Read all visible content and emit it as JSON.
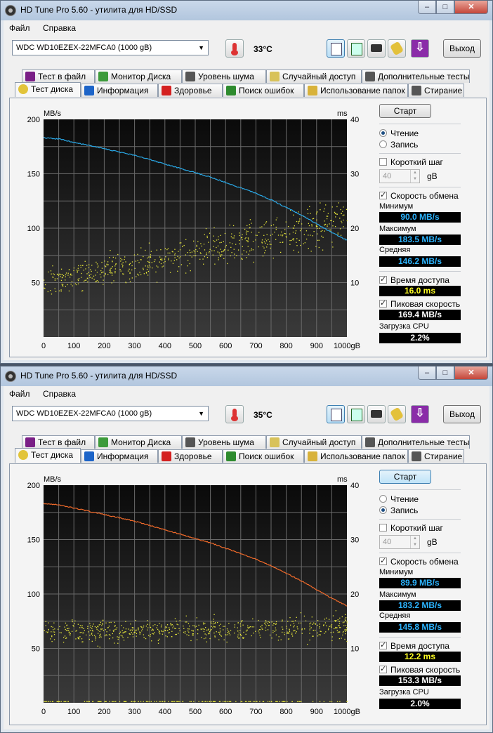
{
  "windows": [
    {
      "title": "HD Tune Pro 5.60 - утилита для HD/SSD",
      "menu": [
        "Файл",
        "Справка"
      ],
      "drive": "WDC WD10EZEX-22MFCA0 (1000 gB)",
      "temperature": "33°C",
      "exit_label": "Выход",
      "tabs_top": [
        "Тест в файл",
        "Монитор Диска",
        "Уровень шума",
        "Случайный доступ",
        "Дополнительные  тесты"
      ],
      "tabs_bottom": [
        "Тест диска",
        "Информация",
        "Здоровье",
        "Поиск ошибок",
        "Использование папок",
        "Стирание"
      ],
      "start_label": "Старт",
      "read_label": "Чтение",
      "write_label": "Запись",
      "mode": "read",
      "short_step_label": "Короткий шаг",
      "short_step_value": "40",
      "short_step_unit": "gB",
      "transfer_rate_label": "Скорость обмена",
      "min_label": "Минимум",
      "min_value": "90.0 MB/s",
      "max_label": "Максимум",
      "max_value": "183.5 MB/s",
      "avg_label": "Средняя",
      "avg_value": "146.2 MB/s",
      "access_time_label": "Время доступа",
      "access_time_value": "16.0 ms",
      "burst_label": "Пиковая скорость",
      "burst_value": "169.4 MB/s",
      "cpu_label": "Загрузка CPU",
      "cpu_value": "2.2%",
      "line_color": "#2aa8e6",
      "chart_data": {
        "type": "line",
        "ylabel_left": "MB/s",
        "ylabel_right": "ms",
        "yticks_left": [
          "200",
          "150",
          "100",
          "50"
        ],
        "yticks_right": [
          "40",
          "30",
          "20",
          "10"
        ],
        "xticks": [
          "0",
          "100",
          "200",
          "300",
          "400",
          "500",
          "600",
          "700",
          "800",
          "900",
          "1000gB"
        ],
        "xlim": [
          0,
          1000
        ],
        "ylim": [
          0,
          200
        ],
        "ylim_right": [
          0,
          40
        ],
        "grid": true,
        "series": [
          {
            "kind": "line",
            "x": [
              0,
              50,
              100,
              150,
              200,
              250,
              300,
              350,
              400,
              450,
              500,
              550,
              600,
              650,
              700,
              750,
              800,
              850,
              900,
              950,
              1000
            ],
            "y": [
              183,
              182,
              179,
              176,
              173,
              170,
              167,
              163,
              159,
              155,
              151,
              147,
              142,
              137,
              132,
              126,
              119,
              112,
              104,
              96,
              89
            ]
          },
          {
            "kind": "scatter",
            "x_range": [
              0,
              1000
            ],
            "ms_low": [
              7,
              10
            ],
            "ms_high": [
              13,
              24
            ],
            "ms_low_end": [
              16,
              20
            ],
            "ms_high_end": [
              22,
              27
            ]
          }
        ]
      }
    },
    {
      "title": "HD Tune Pro 5.60 - утилита для HD/SSD",
      "menu": [
        "Файл",
        "Справка"
      ],
      "drive": "WDC WD10EZEX-22MFCA0 (1000 gB)",
      "temperature": "35°C",
      "exit_label": "Выход",
      "tabs_top": [
        "Тест в файл",
        "Монитор Диска",
        "Уровень шума",
        "Случайный доступ",
        "Дополнительные  тесты"
      ],
      "tabs_bottom": [
        "Тест диска",
        "Информация",
        "Здоровье",
        "Поиск ошибок",
        "Использование папок",
        "Стирание"
      ],
      "start_label": "Старт",
      "read_label": "Чтение",
      "write_label": "Запись",
      "mode": "write",
      "short_step_label": "Короткий шаг",
      "short_step_value": "40",
      "short_step_unit": "gB",
      "transfer_rate_label": "Скорость обмена",
      "min_label": "Минимум",
      "min_value": "89.9 MB/s",
      "max_label": "Максимум",
      "max_value": "183.2 MB/s",
      "avg_label": "Средняя",
      "avg_value": "145.8 MB/s",
      "access_time_label": "Время доступа",
      "access_time_value": "12.2 ms",
      "burst_label": "Пиковая скорость",
      "burst_value": "153.3 MB/s",
      "cpu_label": "Загрузка CPU",
      "cpu_value": "2.0%",
      "line_color": "#f06a2a",
      "chart_data": {
        "type": "line",
        "ylabel_left": "MB/s",
        "ylabel_right": "ms",
        "yticks_left": [
          "200",
          "150",
          "100",
          "50"
        ],
        "yticks_right": [
          "40",
          "30",
          "20",
          "10"
        ],
        "xticks": [
          "0",
          "100",
          "200",
          "300",
          "400",
          "500",
          "600",
          "700",
          "800",
          "900",
          "1000gB"
        ],
        "xlim": [
          0,
          1000
        ],
        "ylim": [
          0,
          200
        ],
        "ylim_right": [
          0,
          40
        ],
        "grid": true,
        "series": [
          {
            "kind": "line",
            "x": [
              0,
              50,
              100,
              150,
              200,
              250,
              300,
              350,
              400,
              450,
              500,
              550,
              600,
              650,
              700,
              750,
              800,
              850,
              900,
              950,
              1000
            ],
            "y": [
              183,
              182,
              179,
              176,
              173,
              170,
              167,
              163,
              159,
              155,
              151,
              147,
              142,
              137,
              132,
              126,
              119,
              112,
              104,
              96,
              89
            ]
          },
          {
            "kind": "scatter",
            "x_range": [
              0,
              1000
            ],
            "ms_low": [
              11,
              13
            ],
            "ms_high": [
              15,
              17
            ],
            "ms_low_end": [
              11,
              13
            ],
            "ms_high_end": [
              15,
              17
            ],
            "ms_floor": 0.3
          }
        ]
      }
    }
  ]
}
